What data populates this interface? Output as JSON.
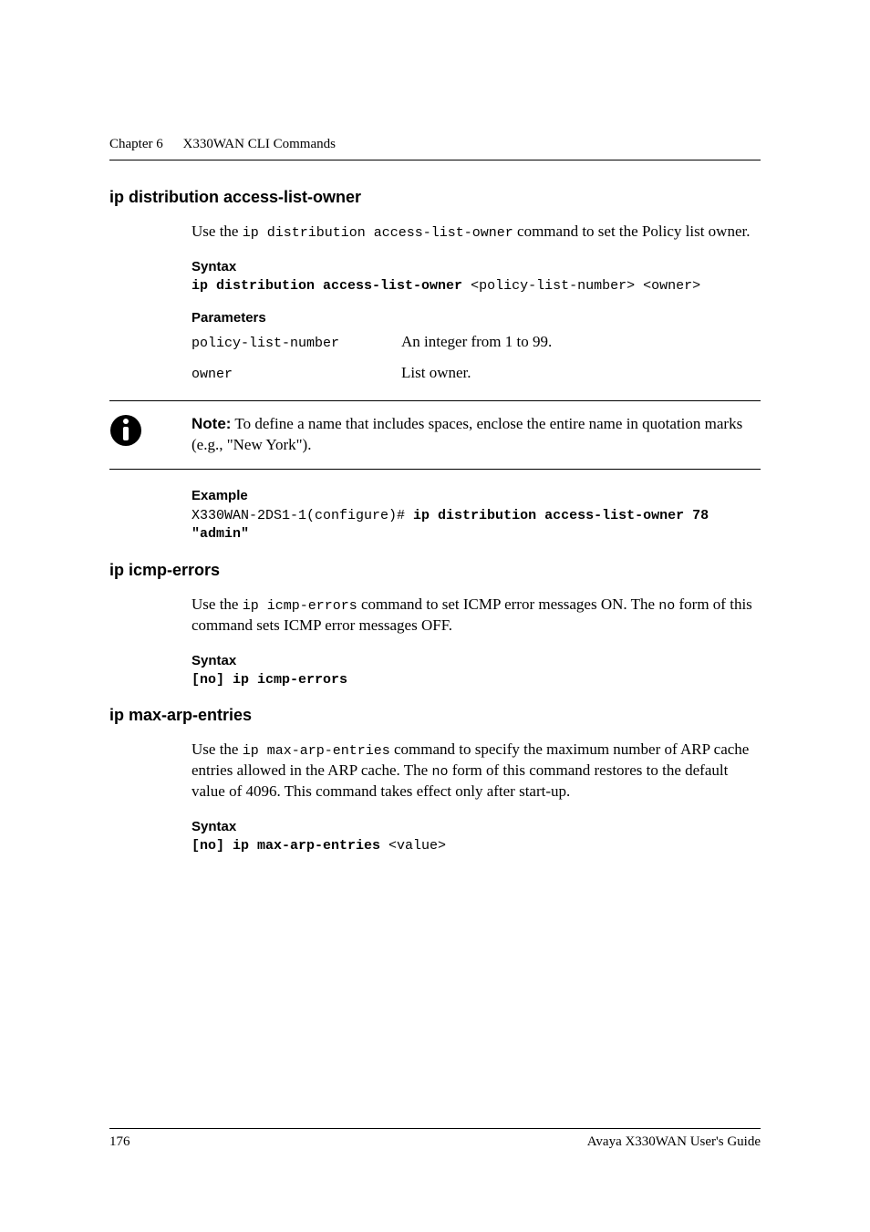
{
  "running_head": {
    "chapter_label": "Chapter 6",
    "chapter_title": "X330WAN CLI Commands"
  },
  "sections": {
    "ip_distribution": {
      "heading": "ip distribution access-list-owner",
      "intro_pre": "Use the ",
      "intro_code": "ip distribution access-list-owner",
      "intro_post": " command to set the Policy list owner.",
      "syntax_label": "Syntax",
      "syntax_bold": "ip distribution access-list-owner",
      "syntax_rest": " <policy-list-number> <owner>",
      "params_label": "Parameters",
      "params": [
        {
          "name": "policy-list-number",
          "desc": "An integer from 1 to 99."
        },
        {
          "name": "owner",
          "desc": "List owner."
        }
      ],
      "note_label": "Note:",
      "note_text": "  To define a name that includes spaces, enclose the entire name in quotation marks (e.g., \"New York\").",
      "example_label": "Example",
      "example_plain": "X330WAN-2DS1-1(configure)# ",
      "example_bold": "ip distribution access-list-owner 78 \n\"admin\""
    },
    "ip_icmp": {
      "heading": "ip icmp-errors",
      "intro_pre": "Use the ",
      "intro_code1": "ip icmp-errors",
      "intro_mid": " command to set ICMP error messages ON. The ",
      "intro_code2": "no",
      "intro_post": " form of this command sets ICMP error messages OFF.",
      "syntax_label": "Syntax",
      "syntax_bold": "[no] ip icmp-errors"
    },
    "ip_max_arp": {
      "heading": "ip max-arp-entries",
      "intro_pre": "Use the ",
      "intro_code1": "ip max-arp-entries",
      "intro_mid": " command to specify the maximum number of ARP cache entries allowed in the ARP cache. The ",
      "intro_code2": "no",
      "intro_post": " form of this command restores to the default value of 4096. This command takes effect only after start-up.",
      "syntax_label": "Syntax",
      "syntax_bold": "[no] ip max-arp-entries",
      "syntax_rest": " <value>"
    }
  },
  "footer": {
    "page_number": "176",
    "doc_title": "Avaya X330WAN User's Guide"
  }
}
